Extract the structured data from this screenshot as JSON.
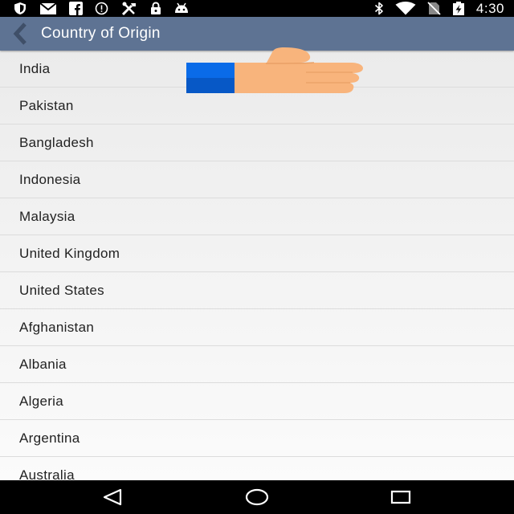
{
  "status_bar": {
    "left_icons": [
      "shield-icon",
      "mail-icon",
      "facebook-icon",
      "data-saver-icon",
      "tools-icon",
      "lock-icon",
      "android-icon"
    ],
    "right_icons": [
      "bluetooth-icon",
      "wifi-icon",
      "no-sim-icon",
      "battery-charging-icon"
    ],
    "time": "4:30"
  },
  "app_bar": {
    "title": "Country of Origin",
    "color": "#5e7393"
  },
  "countries": [
    "India",
    "Pakistan",
    "Bangladesh",
    "Indonesia",
    "Malaysia",
    "United Kingdom",
    "United States",
    "Afghanistan",
    "Albania",
    "Algeria",
    "Argentina",
    "Australia"
  ],
  "overlay": {
    "icon": "thumbs-up-icon",
    "cuff_color": "#0a6be8",
    "hand_color": "#f8b47c"
  },
  "nav_bar": {
    "buttons": [
      "back-triangle-icon",
      "home-circle-icon",
      "recents-square-icon"
    ]
  }
}
